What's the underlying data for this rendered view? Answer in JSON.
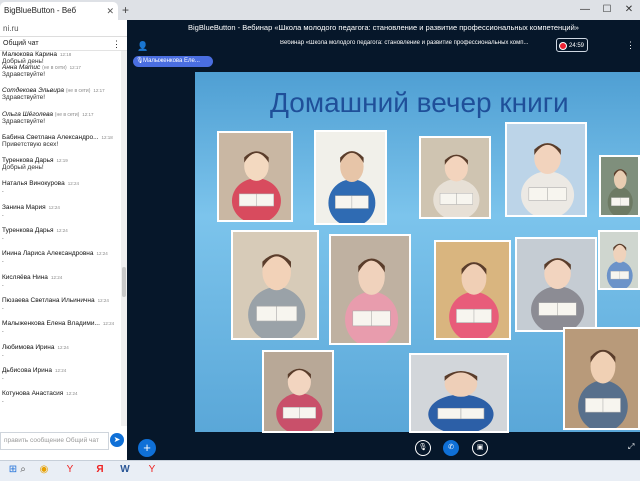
{
  "browser": {
    "tab_title": "BigBlueButton - Веб",
    "address": "ni.ru",
    "window_title": "BigBlueButton - Вебинар «Школа молодого педагога: становление и развитие профессиональных компетенций»"
  },
  "chat": {
    "header": "Общий чат",
    "messages": [
      {
        "name": "Малюкова Карина",
        "time": "12:18",
        "text": "Добрый день!"
      },
      {
        "name": "Анна Матис",
        "role": "(не в сети)",
        "time": "12:17",
        "text": "Здравствуйте!",
        "italic": true
      },
      {
        "name": "Сотдекова Эльвира",
        "role": "(не в сети)",
        "time": "12:17",
        "text": "Здравствуйте!",
        "italic": true
      },
      {
        "name": "Ольга Шёголева",
        "role": "(не в сети)",
        "time": "12:17",
        "text": "Здравствуйте!",
        "italic": true
      },
      {
        "name": "Бабина Светлана Александро...",
        "time": "12:18",
        "text": "Приветствую всех!"
      },
      {
        "name": "Туренкова Дарья",
        "time": "12:19",
        "text": "Добрый день!"
      },
      {
        "name": "Наталья Винокурова",
        "time": "12:24",
        "text": "."
      },
      {
        "name": "Занина Мария",
        "time": "12:24",
        "text": "."
      },
      {
        "name": "Туренкова Дарья",
        "time": "12:24",
        "text": "."
      },
      {
        "name": "Инина Лариса Александровна",
        "time": "12:24",
        "text": "."
      },
      {
        "name": "Кисляёва Нина",
        "time": "12:24",
        "text": "."
      },
      {
        "name": "Пюзаева Светлана Ильинична",
        "time": "12:24",
        "text": "."
      },
      {
        "name": "Малыженкова Елена Владими...",
        "time": "12:24",
        "text": "."
      },
      {
        "name": "Любимова Ирина",
        "time": "12:24",
        "text": "."
      },
      {
        "name": "Дьбисова Ирина",
        "time": "12:24",
        "text": "."
      },
      {
        "name": "Котунова Анастасия",
        "time": "12:24",
        "text": "."
      }
    ],
    "input_placeholder": "править сообщение Общий чат"
  },
  "meeting": {
    "title": "Вебинар «Школа молодого педагога: становление и развитие профессиональных комп...",
    "timer": "24:59",
    "talker": "Малыженкова Еле..."
  },
  "slide": {
    "title": "Домашний вечер книги"
  },
  "colors": {
    "accent": "#0f70d7",
    "app_bg": "#06172a",
    "slide_title": "#1f4f99",
    "record": "#e22233"
  }
}
